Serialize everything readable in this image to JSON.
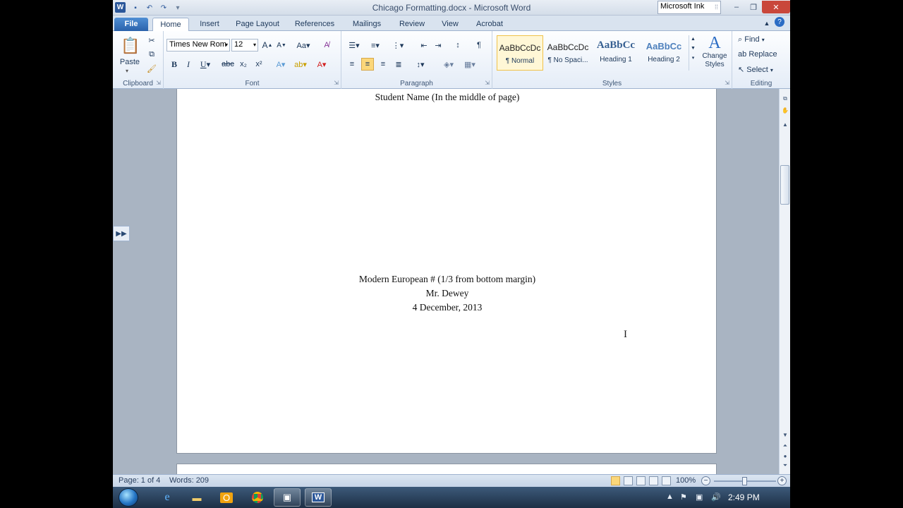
{
  "window": {
    "title": "Chicago Formatting.docx - Microsoft Word",
    "ink_label": "Microsoft Ink",
    "min": "–",
    "max": "❐",
    "close": "✕"
  },
  "tabs": [
    "File",
    "Home",
    "Insert",
    "Page Layout",
    "References",
    "Mailings",
    "Review",
    "View",
    "Acrobat"
  ],
  "ribbon": {
    "clipboard": {
      "paste": "Paste",
      "label": "Clipboard"
    },
    "font": {
      "name": "Times New Rom",
      "size": "12",
      "label": "Font"
    },
    "paragraph": {
      "label": "Paragraph"
    },
    "styles": {
      "items": [
        {
          "sample": "AaBbCcDc",
          "name": "¶ Normal"
        },
        {
          "sample": "AaBbCcDc",
          "name": "¶ No Spaci..."
        },
        {
          "sample": "AaBbCc",
          "name": "Heading 1"
        },
        {
          "sample": "AaBbCc",
          "name": "Heading 2"
        }
      ],
      "change_styles": "Change Styles",
      "label": "Styles"
    },
    "editing": {
      "find": "Find",
      "replace": "Replace",
      "select": "Select",
      "label": "Editing"
    }
  },
  "document": {
    "student_name": "Student Name (In the middle of page)",
    "course": "Modern European # (1/3  from bottom margin)",
    "teacher": "Mr. Dewey",
    "date": "4 December, 2013"
  },
  "status": {
    "page": "Page: 1 of 4",
    "words": "Words: 209",
    "zoom": "100%",
    "zoom_fraction": 0.5
  },
  "taskbar": {
    "time": "2:49 PM"
  }
}
